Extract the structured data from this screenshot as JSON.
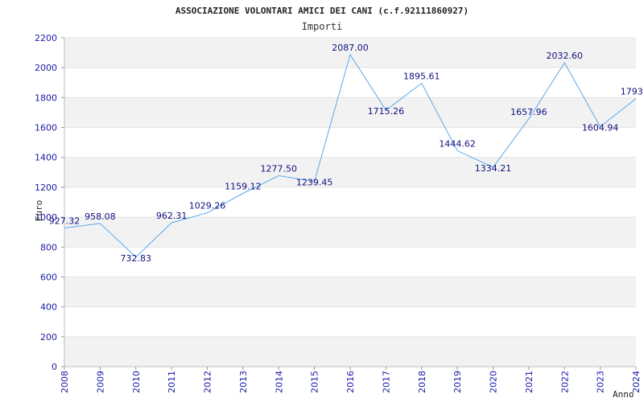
{
  "chart_data": {
    "type": "line",
    "title": "ASSOCIAZIONE VOLONTARI AMICI DEI CANI (c.f.92111860927)",
    "subtitle": "Importi",
    "xlabel": "Anno",
    "ylabel": "Euro",
    "ylim": [
      0,
      2200
    ],
    "y_ticks": [
      "0",
      "200",
      "400",
      "600",
      "800",
      "1000",
      "1200",
      "1400",
      "1600",
      "1800",
      "2000",
      "2200"
    ],
    "grid": "alternating horizontal bands",
    "x": [
      "2008",
      "2009",
      "2010",
      "2011",
      "2012",
      "2013",
      "2014",
      "2015",
      "2016",
      "2017",
      "2018",
      "2019",
      "2020",
      "2021",
      "2022",
      "2023",
      "2024"
    ],
    "values": [
      927.32,
      958.08,
      732.83,
      962.31,
      1029.26,
      1159.12,
      1277.5,
      1239.45,
      2087.0,
      1715.26,
      1895.61,
      1444.62,
      1334.21,
      1657.96,
      2032.6,
      1604.94,
      1793.0
    ],
    "labels": [
      "927.32",
      "958.08",
      "732.83",
      "962.31",
      "1029.26",
      "1159.12",
      "1277.50",
      "1239.45",
      "2087.00",
      "1715.26",
      "1895.61",
      "1444.62",
      "1334.21",
      "1657.96",
      "2032.60",
      "1604.94",
      "1793.0"
    ],
    "colors": {
      "line": "#5aaaee",
      "band": "#f2f2f2",
      "tick_text": "#1a1aa6",
      "label_text": "#101080"
    }
  }
}
